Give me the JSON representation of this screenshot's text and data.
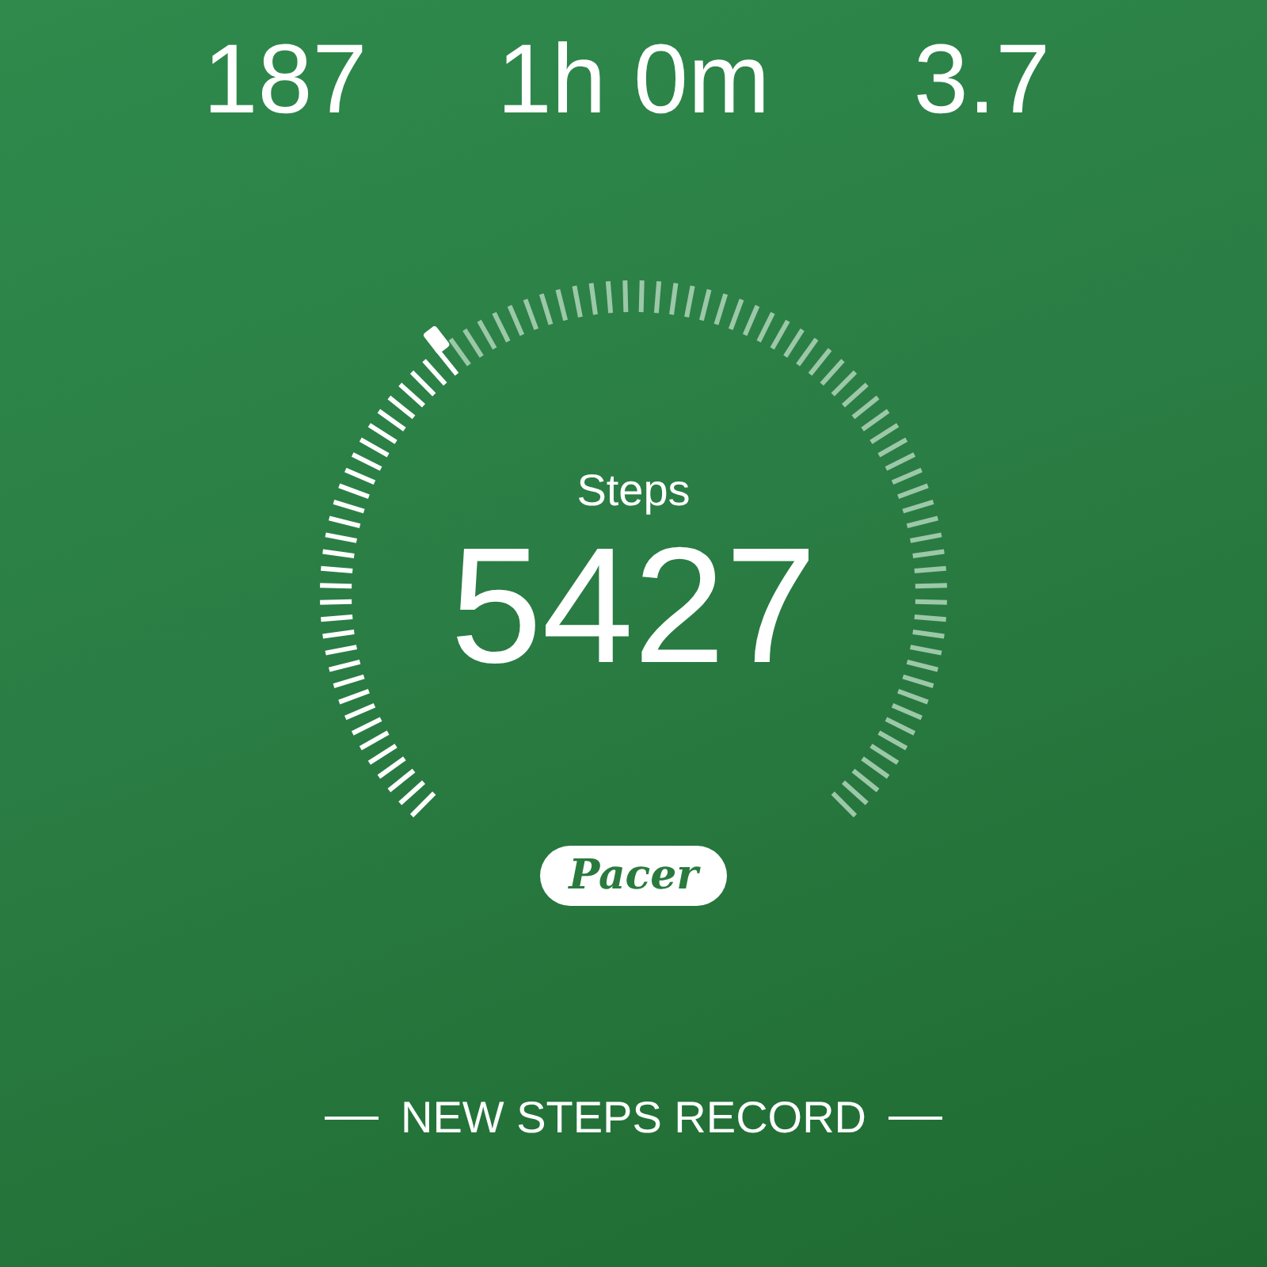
{
  "stats": [
    {
      "value": "187"
    },
    {
      "value": "1h 0m"
    },
    {
      "value": "3.7"
    }
  ],
  "gauge": {
    "label": "Steps",
    "value": "5427"
  },
  "badge": {
    "text": "Pacer"
  },
  "footer": {
    "text": "NEW STEPS RECORD"
  }
}
